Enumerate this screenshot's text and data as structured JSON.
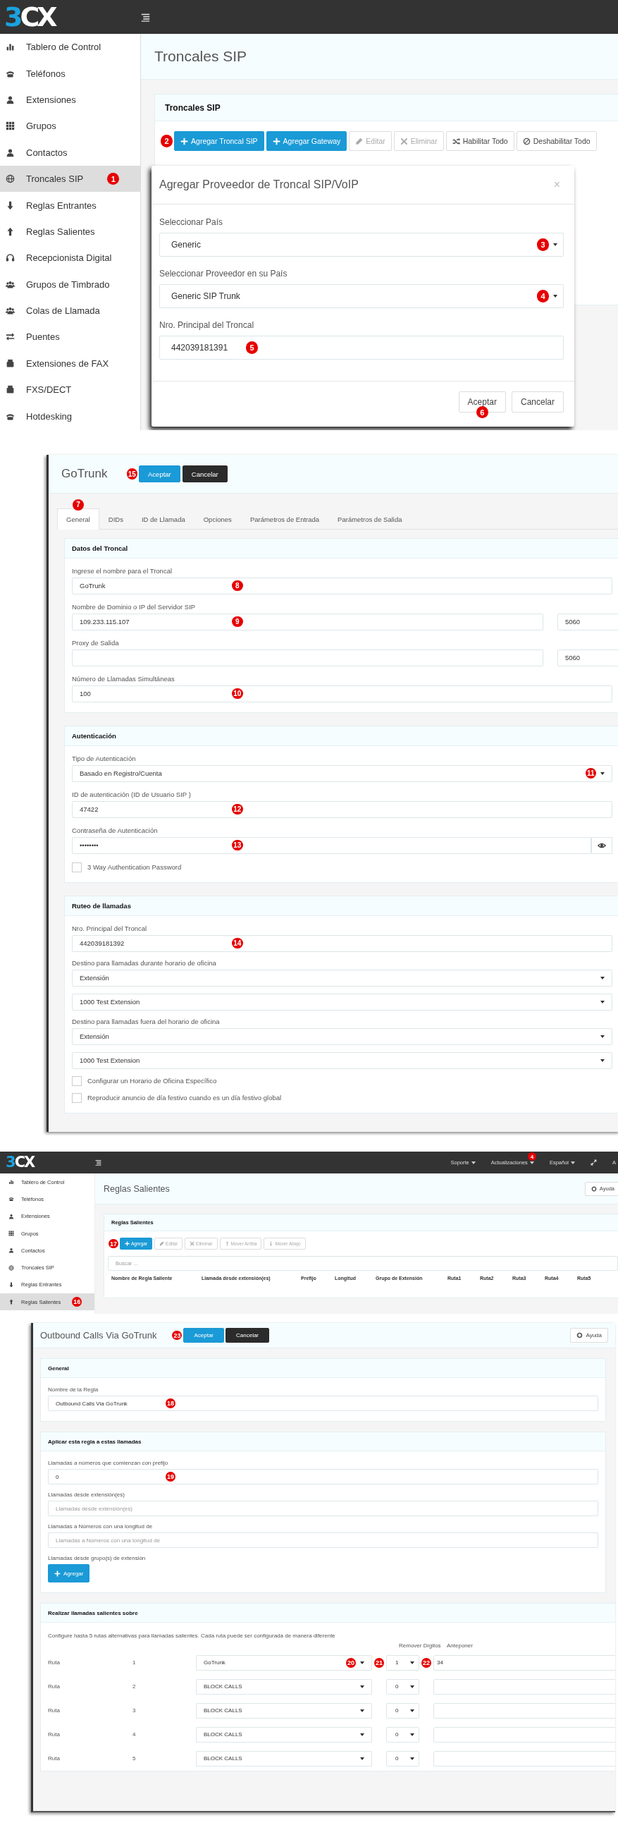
{
  "admin_screen": {
    "logo": "3CX",
    "sidebar": [
      {
        "label": "Tablero de Control",
        "selected": false
      },
      {
        "label": "Teléfonos",
        "selected": false
      },
      {
        "label": "Extensiones",
        "selected": false
      },
      {
        "label": "Grupos",
        "selected": false
      },
      {
        "label": "Contactos",
        "selected": false
      },
      {
        "label": "Troncales SIP",
        "selected": true,
        "marker": "1"
      },
      {
        "label": "Reglas Entrantes",
        "selected": false
      },
      {
        "label": "Reglas Salientes",
        "selected": false
      },
      {
        "label": "Recepcionista Digital",
        "selected": false
      },
      {
        "label": "Grupos de Timbrado",
        "selected": false
      },
      {
        "label": "Colas de Llamada",
        "selected": false
      },
      {
        "label": "Puentes",
        "selected": false
      },
      {
        "label": "Extensiones de FAX",
        "selected": false
      },
      {
        "label": "FXS/DECT",
        "selected": false
      },
      {
        "label": "Hotdesking",
        "selected": false
      }
    ],
    "page_title": "Troncales SIP",
    "card_title": "Troncales SIP",
    "toolbar": [
      {
        "label": "Agregar Troncal SIP",
        "kind": "primary",
        "disabled": false,
        "marker": "2"
      },
      {
        "label": "Agregar Gateway",
        "kind": "primary",
        "disabled": false
      },
      {
        "label": "Editar",
        "kind": "default",
        "disabled": true
      },
      {
        "label": "Eliminar",
        "kind": "default",
        "disabled": true
      },
      {
        "label": "Habilitar Todo",
        "kind": "default",
        "disabled": false
      },
      {
        "label": "Deshabilitar Todo",
        "kind": "default",
        "disabled": false
      }
    ],
    "dialog": {
      "title": "Agregar Proveedor de Troncal SIP/VoIP",
      "close": "×",
      "fields": [
        {
          "label": "Seleccionar País",
          "kind": "select",
          "value": "Generic",
          "marker": "3"
        },
        {
          "label": "Seleccionar Proveedor en su País",
          "kind": "select",
          "value": "Generic SIP Trunk",
          "marker": "4"
        },
        {
          "label": "Nro. Principal del Troncal",
          "kind": "input",
          "value": "442039181391",
          "marker": "5"
        }
      ],
      "buttons": [
        {
          "label": "Aceptar",
          "marker": "6"
        },
        {
          "label": "Cancelar"
        }
      ]
    }
  },
  "trunk_editor": {
    "title": "GoTrunk",
    "buttons": [
      {
        "label": "Aceptar",
        "kind": "primary",
        "marker": "15"
      },
      {
        "label": "Cancelar",
        "kind": "dark"
      }
    ],
    "tabs": [
      {
        "label": "General",
        "selected": true,
        "marker": "7"
      },
      {
        "label": "DIDs",
        "selected": false
      },
      {
        "label": "ID de Llamada",
        "selected": false
      },
      {
        "label": "Opciones",
        "selected": false
      },
      {
        "label": "Parámetros de Entrada",
        "selected": false
      },
      {
        "label": "Parámetros de Salida",
        "selected": false
      }
    ],
    "sections": [
      {
        "title": "Datos del Troncal",
        "fields": [
          {
            "label": "Ingrese el nombre para el Troncal",
            "kind": "input",
            "value": "GoTrunk",
            "marker": "8"
          },
          {
            "label": "Nombre de Dominio o IP del Servidor SIP",
            "kind": "input",
            "value": "109.233.115.107",
            "port": "5060",
            "marker": "9"
          },
          {
            "label": "Proxy de Salida",
            "kind": "input",
            "port": "5060"
          },
          {
            "label": "Número de Llamadas Simultáneas",
            "kind": "input",
            "value": "100",
            "marker": "10"
          }
        ]
      },
      {
        "title": "Autenticación",
        "fields": [
          {
            "label": "Tipo de Autenticación",
            "kind": "select",
            "value": "Basado en Registro/Cuenta",
            "marker": "11"
          },
          {
            "label": "ID de autenticación (ID de Usuario SIP )",
            "kind": "input",
            "value": "47422",
            "marker": "12"
          },
          {
            "label": "Contraseña de Autenticación",
            "kind": "password",
            "value": "••••••••",
            "marker": "13"
          },
          {
            "label": "3 Way Authentication Password",
            "kind": "checkbox",
            "checked": false
          }
        ]
      },
      {
        "title": "Ruteo de llamadas",
        "fields": [
          {
            "label": "Nro. Principal del Troncal",
            "kind": "input",
            "value": "442039181392",
            "marker": "14"
          },
          {
            "label": "Destino para llamadas durante horario de oficina",
            "kind": "select",
            "value": "Extensión"
          },
          {
            "kind": "select",
            "value": "1000 Test Extension"
          },
          {
            "label": "Destino para llamadas fuera del horario de oficina",
            "kind": "select",
            "value": "Extensión"
          },
          {
            "kind": "select",
            "value": "1000 Test Extension"
          },
          {
            "label": "Configurar un Horario de Oficina Específico",
            "kind": "checkbox",
            "checked": false
          },
          {
            "label": "Reproducir anuncio de día festivo cuando es un día festivo global",
            "kind": "checkbox",
            "checked": false
          }
        ]
      }
    ]
  },
  "rules_screen": {
    "logo": "3CX",
    "nav": [
      {
        "label": "Soporte"
      },
      {
        "label": "Actualizaciones",
        "badge": "4"
      },
      {
        "label": "Español"
      }
    ],
    "user_menu": "A",
    "sidebar": [
      {
        "label": "Tablero de Control",
        "selected": false
      },
      {
        "label": "Teléfonos",
        "selected": false
      },
      {
        "label": "Extensiones",
        "selected": false
      },
      {
        "label": "Grupos",
        "selected": false
      },
      {
        "label": "Contactos",
        "selected": false
      },
      {
        "label": "Troncales SIP",
        "selected": false
      },
      {
        "label": "Reglas Entrantes",
        "selected": false
      },
      {
        "label": "Reglas Salientes",
        "selected": true,
        "marker": "16"
      }
    ],
    "page_title": "Reglas Salientes",
    "help": "Ayuda",
    "card_title": "Reglas Salientes",
    "toolbar": [
      {
        "label": "Agregar",
        "kind": "primary",
        "disabled": false,
        "marker": "17"
      },
      {
        "label": "Editar",
        "kind": "default",
        "disabled": true
      },
      {
        "label": "Eliminar",
        "kind": "default",
        "disabled": true
      },
      {
        "label": "Mover Arriba",
        "kind": "default",
        "disabled": true
      },
      {
        "label": "Mover Abajo",
        "kind": "default",
        "disabled": true
      }
    ],
    "search": {
      "placeholder": "Buscar ..."
    },
    "table": {
      "columns": [
        "Nombre de Regla Saliente",
        "Llamada desde extensión(es)",
        "Prefijo",
        "Longitud",
        "Grupo de Extensión",
        "Ruta1",
        "Ruta2",
        "Ruta3",
        "Ruta4",
        "Ruta5"
      ]
    }
  },
  "rule_editor": {
    "title": "Outbound Calls Via GoTrunk",
    "buttons": [
      {
        "label": "Aceptar",
        "kind": "primary",
        "marker": "23"
      },
      {
        "label": "Cancelar",
        "kind": "dark"
      }
    ],
    "help": "Ayuda",
    "sections": [
      {
        "title": "General",
        "fields": [
          {
            "label": "Nombre de la Regla",
            "kind": "input",
            "value": "Outbound Calls Via GoTrunk",
            "marker": "18"
          }
        ]
      },
      {
        "title": "Aplicar esta regla a estas llamadas",
        "fields": [
          {
            "label": "Llamadas a números que comienzan con prefijo",
            "kind": "input",
            "value": "0",
            "marker": "19"
          },
          {
            "label": "Llamadas desde extensión(es)",
            "kind": "input",
            "placeholder": "Llamadas desde extensión(es)"
          },
          {
            "label": "Llamadas a Números con una longitud de",
            "kind": "input",
            "placeholder": "Llamadas a Números con una longitud de"
          },
          {
            "label": "Llamadas desde grupo(s) de extensión",
            "kind": "button",
            "button": "Agregar"
          }
        ]
      }
    ],
    "routes": {
      "title": "Realizar llamadas salientes sobre",
      "description": "Configure hasta 5 rutas alternativas para llamadas salientes. Cada ruta puede ser configurada de manera diferente",
      "strip_header": "Remover Dígitos",
      "prepend_header": "Anteponer",
      "rows": [
        {
          "label": "Ruta",
          "number": "1",
          "trunk": "GoTrunk",
          "strip": "1",
          "prepend": "34",
          "trunk_marker": "20",
          "strip_marker": "21",
          "prepend_marker": "22"
        },
        {
          "label": "Ruta",
          "number": "2",
          "trunk": "BLOCK CALLS",
          "strip": "0"
        },
        {
          "label": "Ruta",
          "number": "3",
          "trunk": "BLOCK CALLS",
          "strip": "0"
        },
        {
          "label": "Ruta",
          "number": "4",
          "trunk": "BLOCK CALLS",
          "strip": "0"
        },
        {
          "label": "Ruta",
          "number": "5",
          "trunk": "BLOCK CALLS",
          "strip": "0"
        }
      ]
    }
  }
}
